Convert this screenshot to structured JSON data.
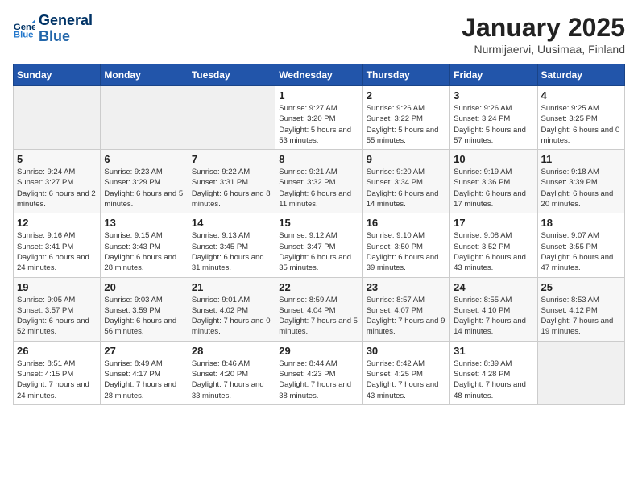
{
  "header": {
    "logo_line1": "General",
    "logo_line2": "Blue",
    "title": "January 2025",
    "subtitle": "Nurmijaervi, Uusimaa, Finland"
  },
  "days_of_week": [
    "Sunday",
    "Monday",
    "Tuesday",
    "Wednesday",
    "Thursday",
    "Friday",
    "Saturday"
  ],
  "weeks": [
    [
      {
        "day": "",
        "info": ""
      },
      {
        "day": "",
        "info": ""
      },
      {
        "day": "",
        "info": ""
      },
      {
        "day": "1",
        "info": "Sunrise: 9:27 AM\nSunset: 3:20 PM\nDaylight: 5 hours\nand 53 minutes."
      },
      {
        "day": "2",
        "info": "Sunrise: 9:26 AM\nSunset: 3:22 PM\nDaylight: 5 hours\nand 55 minutes."
      },
      {
        "day": "3",
        "info": "Sunrise: 9:26 AM\nSunset: 3:24 PM\nDaylight: 5 hours\nand 57 minutes."
      },
      {
        "day": "4",
        "info": "Sunrise: 9:25 AM\nSunset: 3:25 PM\nDaylight: 6 hours\nand 0 minutes."
      }
    ],
    [
      {
        "day": "5",
        "info": "Sunrise: 9:24 AM\nSunset: 3:27 PM\nDaylight: 6 hours\nand 2 minutes."
      },
      {
        "day": "6",
        "info": "Sunrise: 9:23 AM\nSunset: 3:29 PM\nDaylight: 6 hours\nand 5 minutes."
      },
      {
        "day": "7",
        "info": "Sunrise: 9:22 AM\nSunset: 3:31 PM\nDaylight: 6 hours\nand 8 minutes."
      },
      {
        "day": "8",
        "info": "Sunrise: 9:21 AM\nSunset: 3:32 PM\nDaylight: 6 hours\nand 11 minutes."
      },
      {
        "day": "9",
        "info": "Sunrise: 9:20 AM\nSunset: 3:34 PM\nDaylight: 6 hours\nand 14 minutes."
      },
      {
        "day": "10",
        "info": "Sunrise: 9:19 AM\nSunset: 3:36 PM\nDaylight: 6 hours\nand 17 minutes."
      },
      {
        "day": "11",
        "info": "Sunrise: 9:18 AM\nSunset: 3:39 PM\nDaylight: 6 hours\nand 20 minutes."
      }
    ],
    [
      {
        "day": "12",
        "info": "Sunrise: 9:16 AM\nSunset: 3:41 PM\nDaylight: 6 hours\nand 24 minutes."
      },
      {
        "day": "13",
        "info": "Sunrise: 9:15 AM\nSunset: 3:43 PM\nDaylight: 6 hours\nand 28 minutes."
      },
      {
        "day": "14",
        "info": "Sunrise: 9:13 AM\nSunset: 3:45 PM\nDaylight: 6 hours\nand 31 minutes."
      },
      {
        "day": "15",
        "info": "Sunrise: 9:12 AM\nSunset: 3:47 PM\nDaylight: 6 hours\nand 35 minutes."
      },
      {
        "day": "16",
        "info": "Sunrise: 9:10 AM\nSunset: 3:50 PM\nDaylight: 6 hours\nand 39 minutes."
      },
      {
        "day": "17",
        "info": "Sunrise: 9:08 AM\nSunset: 3:52 PM\nDaylight: 6 hours\nand 43 minutes."
      },
      {
        "day": "18",
        "info": "Sunrise: 9:07 AM\nSunset: 3:55 PM\nDaylight: 6 hours\nand 47 minutes."
      }
    ],
    [
      {
        "day": "19",
        "info": "Sunrise: 9:05 AM\nSunset: 3:57 PM\nDaylight: 6 hours\nand 52 minutes."
      },
      {
        "day": "20",
        "info": "Sunrise: 9:03 AM\nSunset: 3:59 PM\nDaylight: 6 hours\nand 56 minutes."
      },
      {
        "day": "21",
        "info": "Sunrise: 9:01 AM\nSunset: 4:02 PM\nDaylight: 7 hours\nand 0 minutes."
      },
      {
        "day": "22",
        "info": "Sunrise: 8:59 AM\nSunset: 4:04 PM\nDaylight: 7 hours\nand 5 minutes."
      },
      {
        "day": "23",
        "info": "Sunrise: 8:57 AM\nSunset: 4:07 PM\nDaylight: 7 hours\nand 9 minutes."
      },
      {
        "day": "24",
        "info": "Sunrise: 8:55 AM\nSunset: 4:10 PM\nDaylight: 7 hours\nand 14 minutes."
      },
      {
        "day": "25",
        "info": "Sunrise: 8:53 AM\nSunset: 4:12 PM\nDaylight: 7 hours\nand 19 minutes."
      }
    ],
    [
      {
        "day": "26",
        "info": "Sunrise: 8:51 AM\nSunset: 4:15 PM\nDaylight: 7 hours\nand 24 minutes."
      },
      {
        "day": "27",
        "info": "Sunrise: 8:49 AM\nSunset: 4:17 PM\nDaylight: 7 hours\nand 28 minutes."
      },
      {
        "day": "28",
        "info": "Sunrise: 8:46 AM\nSunset: 4:20 PM\nDaylight: 7 hours\nand 33 minutes."
      },
      {
        "day": "29",
        "info": "Sunrise: 8:44 AM\nSunset: 4:23 PM\nDaylight: 7 hours\nand 38 minutes."
      },
      {
        "day": "30",
        "info": "Sunrise: 8:42 AM\nSunset: 4:25 PM\nDaylight: 7 hours\nand 43 minutes."
      },
      {
        "day": "31",
        "info": "Sunrise: 8:39 AM\nSunset: 4:28 PM\nDaylight: 7 hours\nand 48 minutes."
      },
      {
        "day": "",
        "info": ""
      }
    ]
  ]
}
